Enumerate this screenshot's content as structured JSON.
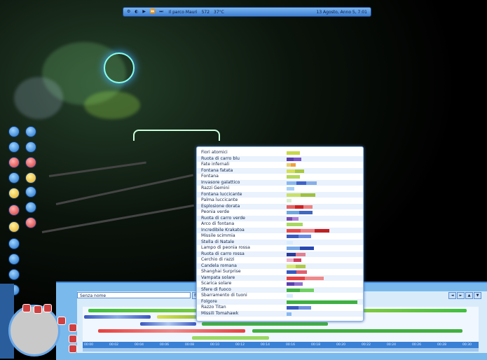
{
  "status_bar": {
    "icons_text": "⚙ ◐ ▶ ⏩ ⏭",
    "park_name": "Il parco Mauri",
    "money": "572",
    "temperature": "37°C",
    "date": "13 Agosto, Anno 5, 7:01"
  },
  "sequence_name": "Senza nome",
  "sequence_field_suffix": "E.",
  "fireworks_list": [
    {
      "name": "Fiori atomici",
      "colors": [
        "#c8d84a"
      ]
    },
    {
      "name": "Ruota di carro blu",
      "colors": [
        "#5a3fa8",
        "#7a56c6"
      ]
    },
    {
      "name": "Fate infernali",
      "colors": [
        "#e8d070",
        "#f0a040"
      ]
    },
    {
      "name": "Fontana fatata",
      "colors": [
        "#d4e050",
        "#a8c83c"
      ]
    },
    {
      "name": "Fontana",
      "colors": [
        "#b4d85a"
      ]
    },
    {
      "name": "Invasore galattico",
      "colors": [
        "#8ab8f0",
        "#3f62c8",
        "#88aee6"
      ]
    },
    {
      "name": "Razzi Gemini",
      "colors": [
        "#a8d0f8"
      ]
    },
    {
      "name": "Fontana luccicante",
      "colors": [
        "#c8e068",
        "#a0c040"
      ]
    },
    {
      "name": "Palma luccicante",
      "colors": [
        "#d8f0d0"
      ]
    },
    {
      "name": "Esplosione dorata",
      "colors": [
        "#e86060",
        "#d02020",
        "#f08080"
      ]
    },
    {
      "name": "Peonia verde",
      "colors": [
        "#6fa8e0",
        "#4168c0"
      ]
    },
    {
      "name": "Ruota di carro verde",
      "colors": [
        "#7a4ab0",
        "#b080d8"
      ]
    },
    {
      "name": "Arco di fontana",
      "colors": [
        "#a8d860"
      ]
    },
    {
      "name": "Incredibile Krakatoa",
      "colors": [
        "#e84848",
        "#f08080",
        "#c02020"
      ]
    },
    {
      "name": "Missile scimmia",
      "colors": [
        "#3a5ac0",
        "#6a8ae0"
      ]
    },
    {
      "name": "Stella di Natale",
      "colors": [
        "#d8ecff"
      ]
    },
    {
      "name": "Lampo di peonia rossa",
      "colors": [
        "#78a8e8",
        "#2848b0"
      ]
    },
    {
      "name": "Ruota di carro rossa",
      "colors": [
        "#2a3a98",
        "#e08090"
      ]
    },
    {
      "name": "Cerchio di razzi",
      "colors": [
        "#f0b0c8",
        "#d04060"
      ]
    },
    {
      "name": "Candela romana",
      "colors": [
        "#d8e870",
        "#b0c848"
      ]
    },
    {
      "name": "Shanghai Surprise",
      "colors": [
        "#3a58c0",
        "#e06070"
      ]
    },
    {
      "name": "Vampata solare",
      "colors": [
        "#e84040",
        "#f08888"
      ]
    },
    {
      "name": "Scarica solare",
      "colors": [
        "#5a40b0",
        "#9070d0"
      ]
    },
    {
      "name": "Sfere di fuoco",
      "colors": [
        "#40b040",
        "#70d060"
      ]
    },
    {
      "name": "Sbarramento di tuoni",
      "colors": [
        "#d8ecff"
      ]
    },
    {
      "name": "Folgore",
      "colors": [
        "#40b040"
      ]
    },
    {
      "name": "Razzo Titan",
      "colors": [
        "#3a58c0",
        "#7090e0"
      ]
    },
    {
      "name": "Missili Tomahawk",
      "colors": [
        "#8ab8f0"
      ]
    }
  ],
  "timeline_ticks": [
    "00:00",
    "00:02",
    "00:04",
    "00:06",
    "00:08",
    "00:10",
    "00:12",
    "00:14",
    "00:16",
    "00:18",
    "00:20",
    "00:22",
    "00:24",
    "00:26",
    "00:28",
    "00:30"
  ],
  "right_buttons": [
    "◄",
    "►",
    "▲",
    "▼"
  ]
}
